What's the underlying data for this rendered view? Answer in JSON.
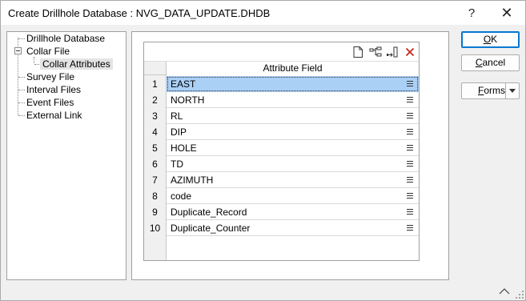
{
  "window": {
    "title": "Create Drillhole Database : NVG_DATA_UPDATE.DHDB",
    "help_glyph": "?",
    "close_glyph": "✕"
  },
  "tree": {
    "items": [
      {
        "label": "Drillhole Database"
      },
      {
        "label": "Collar File"
      },
      {
        "label": "Collar Attributes"
      },
      {
        "label": "Survey File"
      },
      {
        "label": "Interval Files"
      },
      {
        "label": "Event Files"
      },
      {
        "label": "External Link"
      }
    ]
  },
  "grid": {
    "column_header": "Attribute Field",
    "rows": [
      {
        "num": "1",
        "value": "EAST"
      },
      {
        "num": "2",
        "value": "NORTH"
      },
      {
        "num": "3",
        "value": "RL"
      },
      {
        "num": "4",
        "value": "DIP"
      },
      {
        "num": "5",
        "value": "HOLE"
      },
      {
        "num": "6",
        "value": "TD"
      },
      {
        "num": "7",
        "value": "AZIMUTH"
      },
      {
        "num": "8",
        "value": "code"
      },
      {
        "num": "9",
        "value": "Duplicate_Record"
      },
      {
        "num": "10",
        "value": "Duplicate_Counter"
      }
    ],
    "toolbar_icons": [
      "new-document-icon",
      "insert-row-icon",
      "append-row-icon",
      "delete-icon"
    ],
    "selected_row": 1
  },
  "buttons": {
    "ok": {
      "pre": "",
      "mnemonic": "O",
      "post": "K"
    },
    "cancel": {
      "pre": "",
      "mnemonic": "C",
      "post": "ancel"
    },
    "forms": {
      "pre": "",
      "mnemonic": "F",
      "post": "orms"
    }
  },
  "colors": {
    "selection": "#aad0f6",
    "delete_icon": "#c42b1c",
    "default_button_border": "#0078d4"
  }
}
